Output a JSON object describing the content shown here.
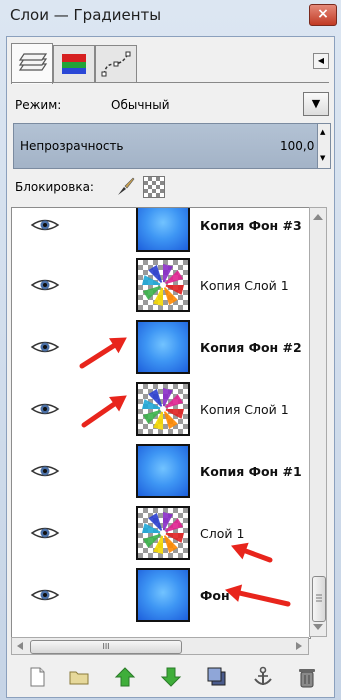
{
  "window": {
    "title": "Слои — Градиенты",
    "close_glyph": "×"
  },
  "tabs": [
    {
      "icon": "layers-tab-icon",
      "selected": true
    },
    {
      "icon": "channels-tab-icon",
      "selected": false
    },
    {
      "icon": "paths-tab-icon",
      "selected": false
    }
  ],
  "mode": {
    "label": "Режим:",
    "value": "Обычный"
  },
  "opacity": {
    "label": "Непрозрачность",
    "value": "100,0"
  },
  "lock": {
    "label": "Блокировка:"
  },
  "layers": [
    {
      "name": "Копия Фон #3",
      "thumb": "blue",
      "bold": true,
      "visible": true
    },
    {
      "name": "Копия Слой 1",
      "thumb": "pinwheel",
      "bold": false,
      "visible": true
    },
    {
      "name": "Копия Фон #2",
      "thumb": "blue",
      "bold": true,
      "visible": true
    },
    {
      "name": "Копия Слой 1",
      "thumb": "pinwheel",
      "bold": false,
      "visible": true
    },
    {
      "name": "Копия Фон #1",
      "thumb": "blue",
      "bold": true,
      "visible": true
    },
    {
      "name": "Слой 1",
      "thumb": "pinwheel",
      "bold": false,
      "visible": true
    },
    {
      "name": "Фон",
      "thumb": "blue",
      "bold": true,
      "visible": true
    }
  ],
  "hscroll_grip": "III",
  "bottom_buttons": [
    "new-layer-icon",
    "layer-group-icon",
    "raise-layer-icon",
    "lower-layer-icon",
    "duplicate-layer-icon",
    "anchor-layer-icon",
    "delete-layer-icon"
  ],
  "colors": {
    "annotation_arrow": "#e8251c",
    "selection_accent": "#a9b9cd"
  }
}
